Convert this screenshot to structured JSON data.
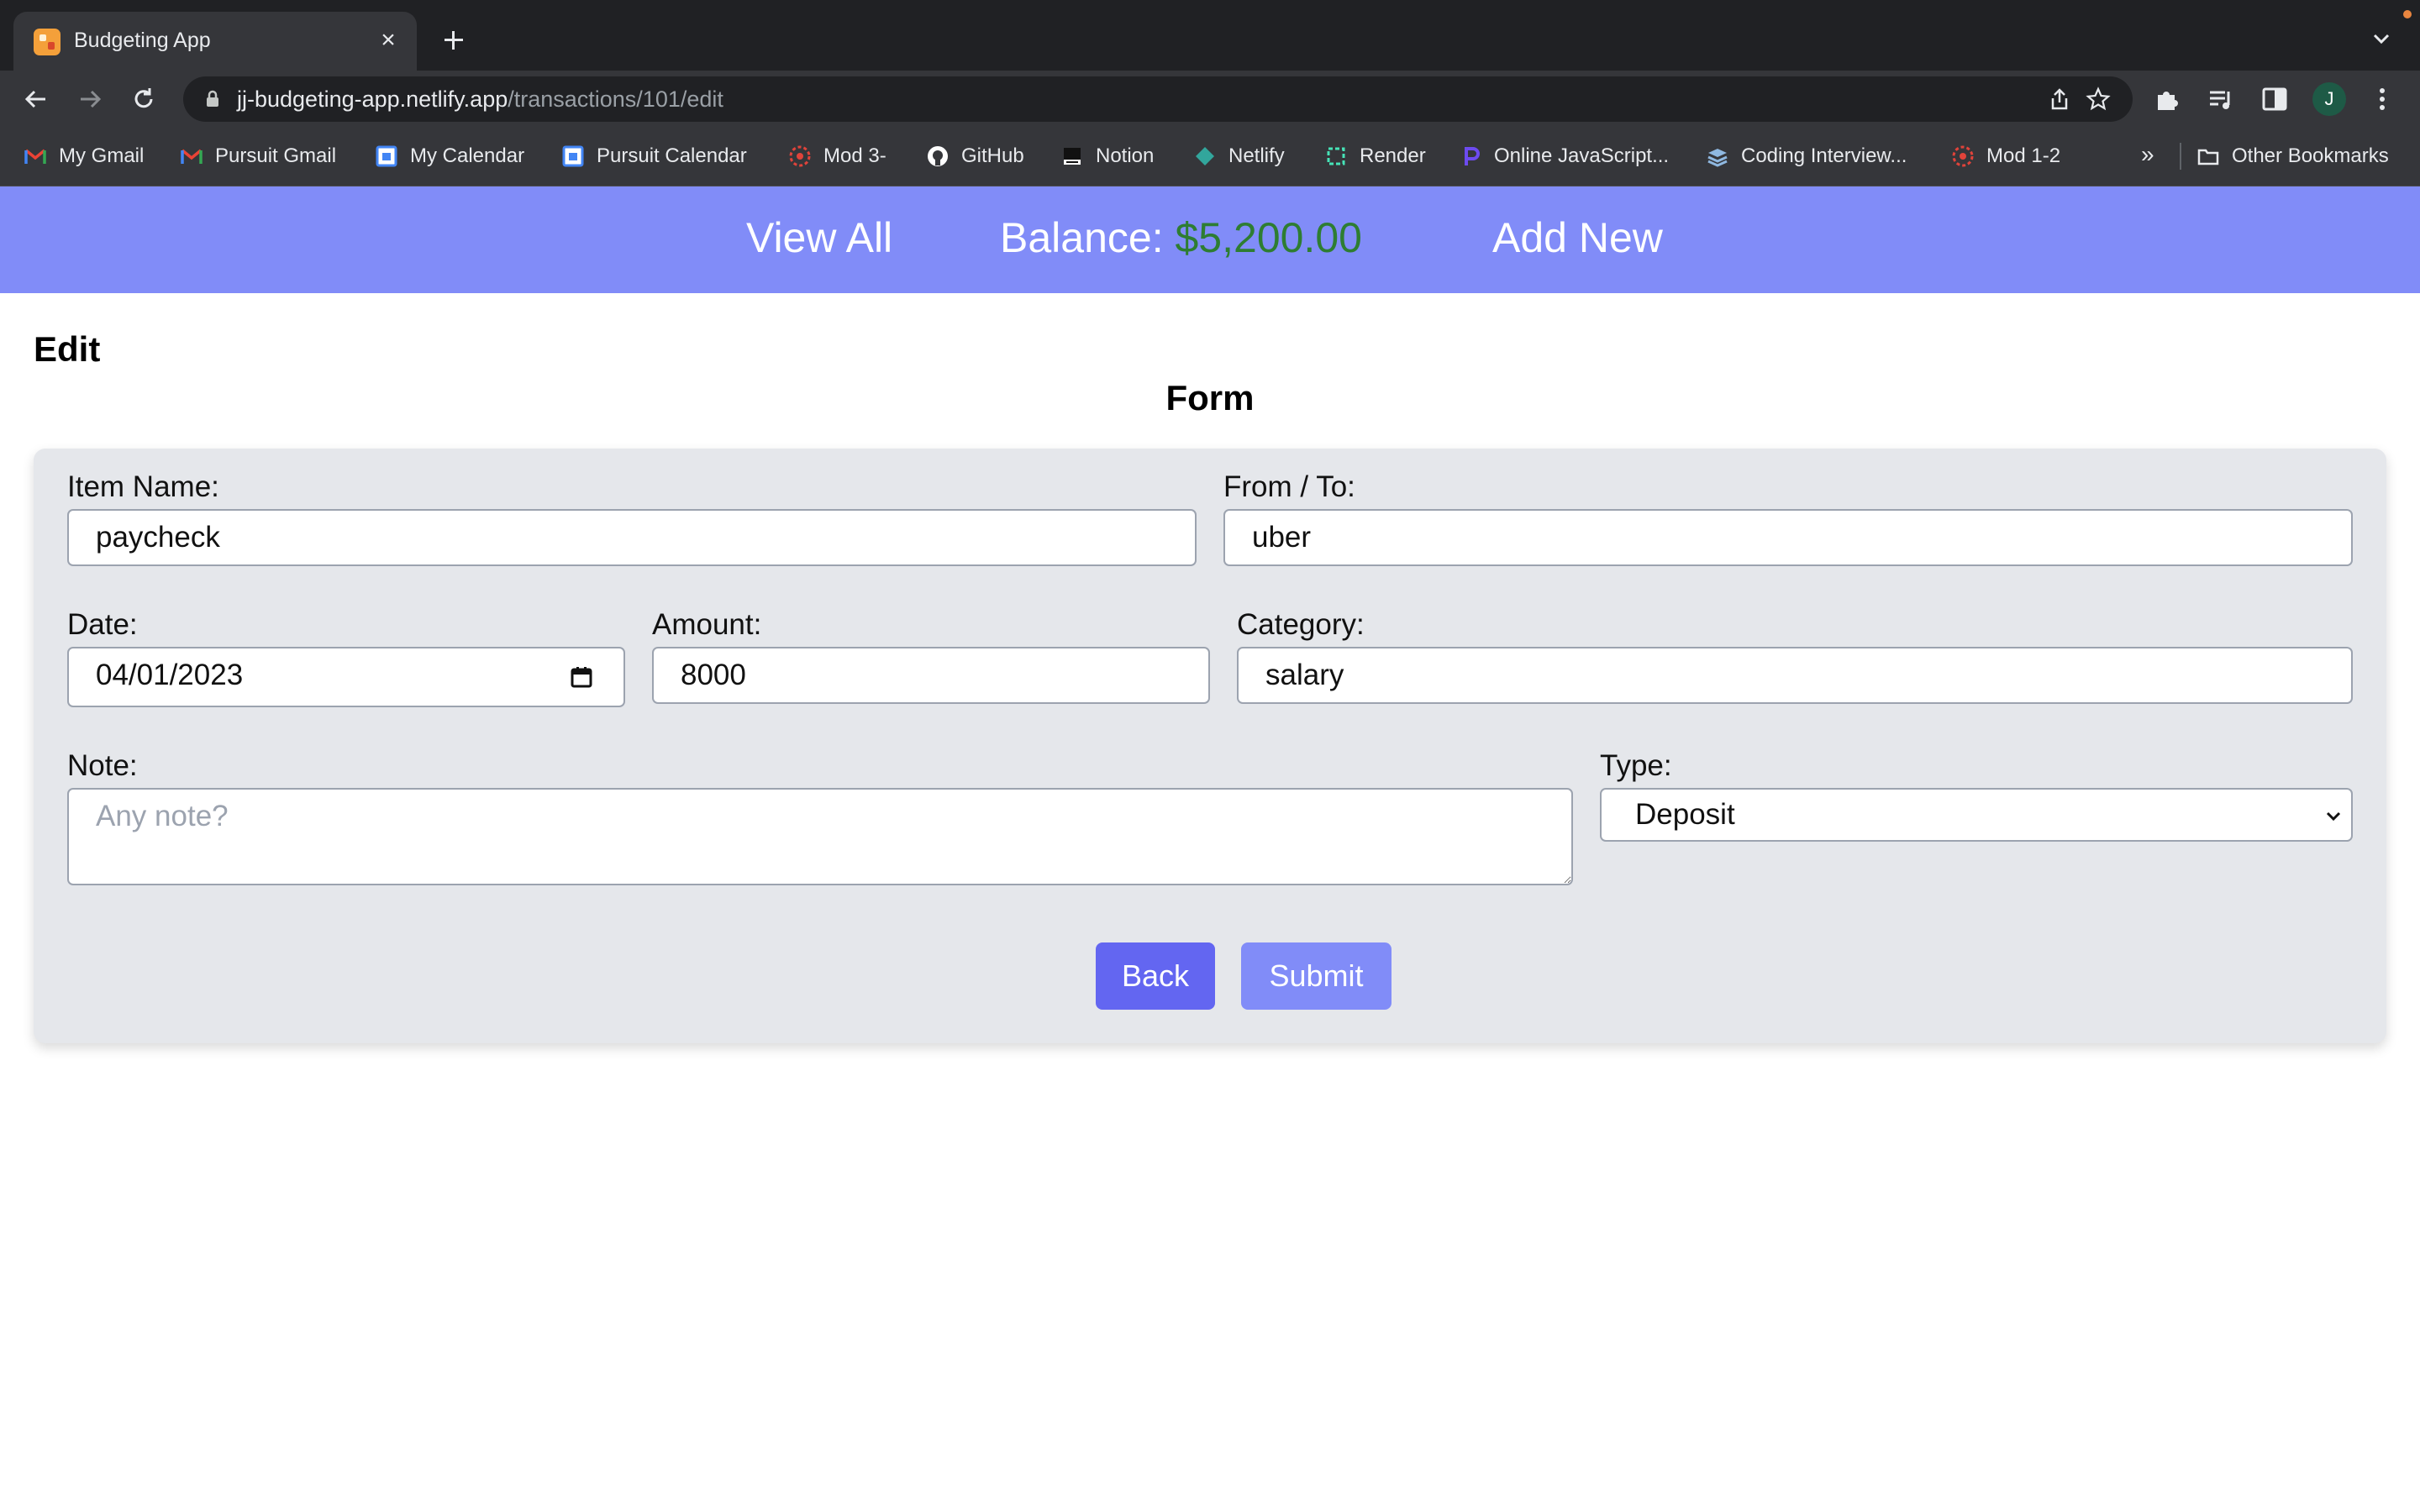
{
  "browser": {
    "tab_title": "Budgeting App",
    "tab_close": "×",
    "url_host": "jj-budgeting-app.netlify.app",
    "url_path": "/transactions/101/edit",
    "profile_initial": "J",
    "bookmarks": [
      {
        "label": "My Gmail",
        "icon": "gmail-icon"
      },
      {
        "label": "Pursuit Gmail",
        "icon": "gmail-icon"
      },
      {
        "label": "My Calendar",
        "icon": "calendar-icon"
      },
      {
        "label": "Pursuit Calendar",
        "icon": "calendar-icon"
      },
      {
        "label": "Mod 3-",
        "icon": "pursuit-icon"
      },
      {
        "label": "GitHub",
        "icon": "github-icon"
      },
      {
        "label": "Notion",
        "icon": "notion-icon"
      },
      {
        "label": "Netlify",
        "icon": "netlify-icon"
      },
      {
        "label": "Render",
        "icon": "render-icon"
      },
      {
        "label": "Online JavaScript...",
        "icon": "programiz-icon"
      },
      {
        "label": "Coding Interview...",
        "icon": "layers-icon"
      },
      {
        "label": "Mod 1-2",
        "icon": "pursuit-icon"
      }
    ],
    "bookmarks_more": "»",
    "other_bookmarks": "Other Bookmarks"
  },
  "nav": {
    "view_all": "View All",
    "balance_label": "Balance:",
    "balance_amount": "$5,200.00",
    "add_new": "Add New"
  },
  "page": {
    "heading": "Edit",
    "form_heading": "Form"
  },
  "form": {
    "item_name_label": "Item Name:",
    "item_name_value": "paycheck",
    "from_to_label": "From / To:",
    "from_to_value": "uber",
    "date_label": "Date:",
    "date_value": "04/01/2023",
    "amount_label": "Amount:",
    "amount_value": "8000",
    "category_label": "Category:",
    "category_value": "salary",
    "note_label": "Note:",
    "note_placeholder": "Any note?",
    "type_label": "Type:",
    "type_value": "Deposit",
    "back_label": "Back",
    "submit_label": "Submit"
  },
  "colors": {
    "nav_bg": "#818cf8",
    "balance_green": "#2e7d32",
    "back_button": "#6366f1",
    "submit_button": "#818cf8",
    "form_bg": "#e5e7eb"
  }
}
